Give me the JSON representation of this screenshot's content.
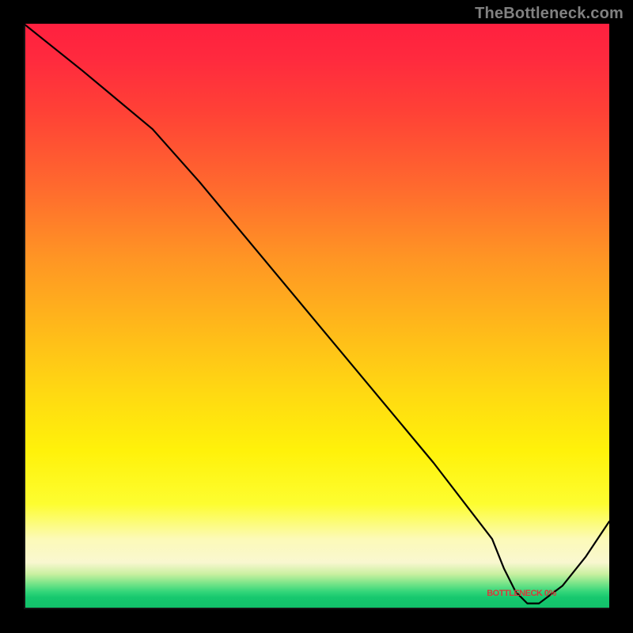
{
  "branding": {
    "watermark": "TheBottleneck.com"
  },
  "chart_data": {
    "type": "line",
    "title": "",
    "xlabel": "",
    "ylabel": "",
    "xlim": [
      0,
      100
    ],
    "ylim": [
      0,
      100
    ],
    "series": [
      {
        "name": "bottleneck-curve",
        "x": [
          0,
          10,
          22,
          30,
          40,
          50,
          60,
          70,
          80,
          82,
          84,
          86,
          88,
          92,
          96,
          100
        ],
        "y": [
          100,
          92,
          82,
          73,
          61,
          49,
          37,
          25,
          12,
          7,
          3,
          1,
          1,
          4,
          9,
          15
        ]
      }
    ],
    "annotations": [
      {
        "name": "min-label",
        "text": "BOTTLENECK 0%",
        "x": 85,
        "y": 2
      }
    ],
    "background_gradient": {
      "top": "#ff203f",
      "mid": "#fff20a",
      "bottom": "#12c06a"
    }
  }
}
